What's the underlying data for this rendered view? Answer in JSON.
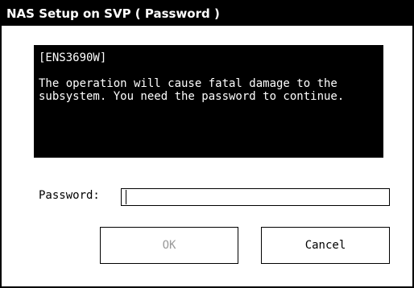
{
  "window": {
    "title": "NAS Setup on SVP ( Password )"
  },
  "message": {
    "code": "[ENS3690W]",
    "text": "The operation will cause fatal damage to the subsystem. You need the password to continue."
  },
  "password": {
    "label": "Password:",
    "value": ""
  },
  "buttons": {
    "ok_label": "OK",
    "ok_enabled": false,
    "cancel_label": "Cancel"
  },
  "colors": {
    "title_bar_bg": "#000000",
    "message_bg": "#000000",
    "disabled_text": "#9a9a9a"
  }
}
